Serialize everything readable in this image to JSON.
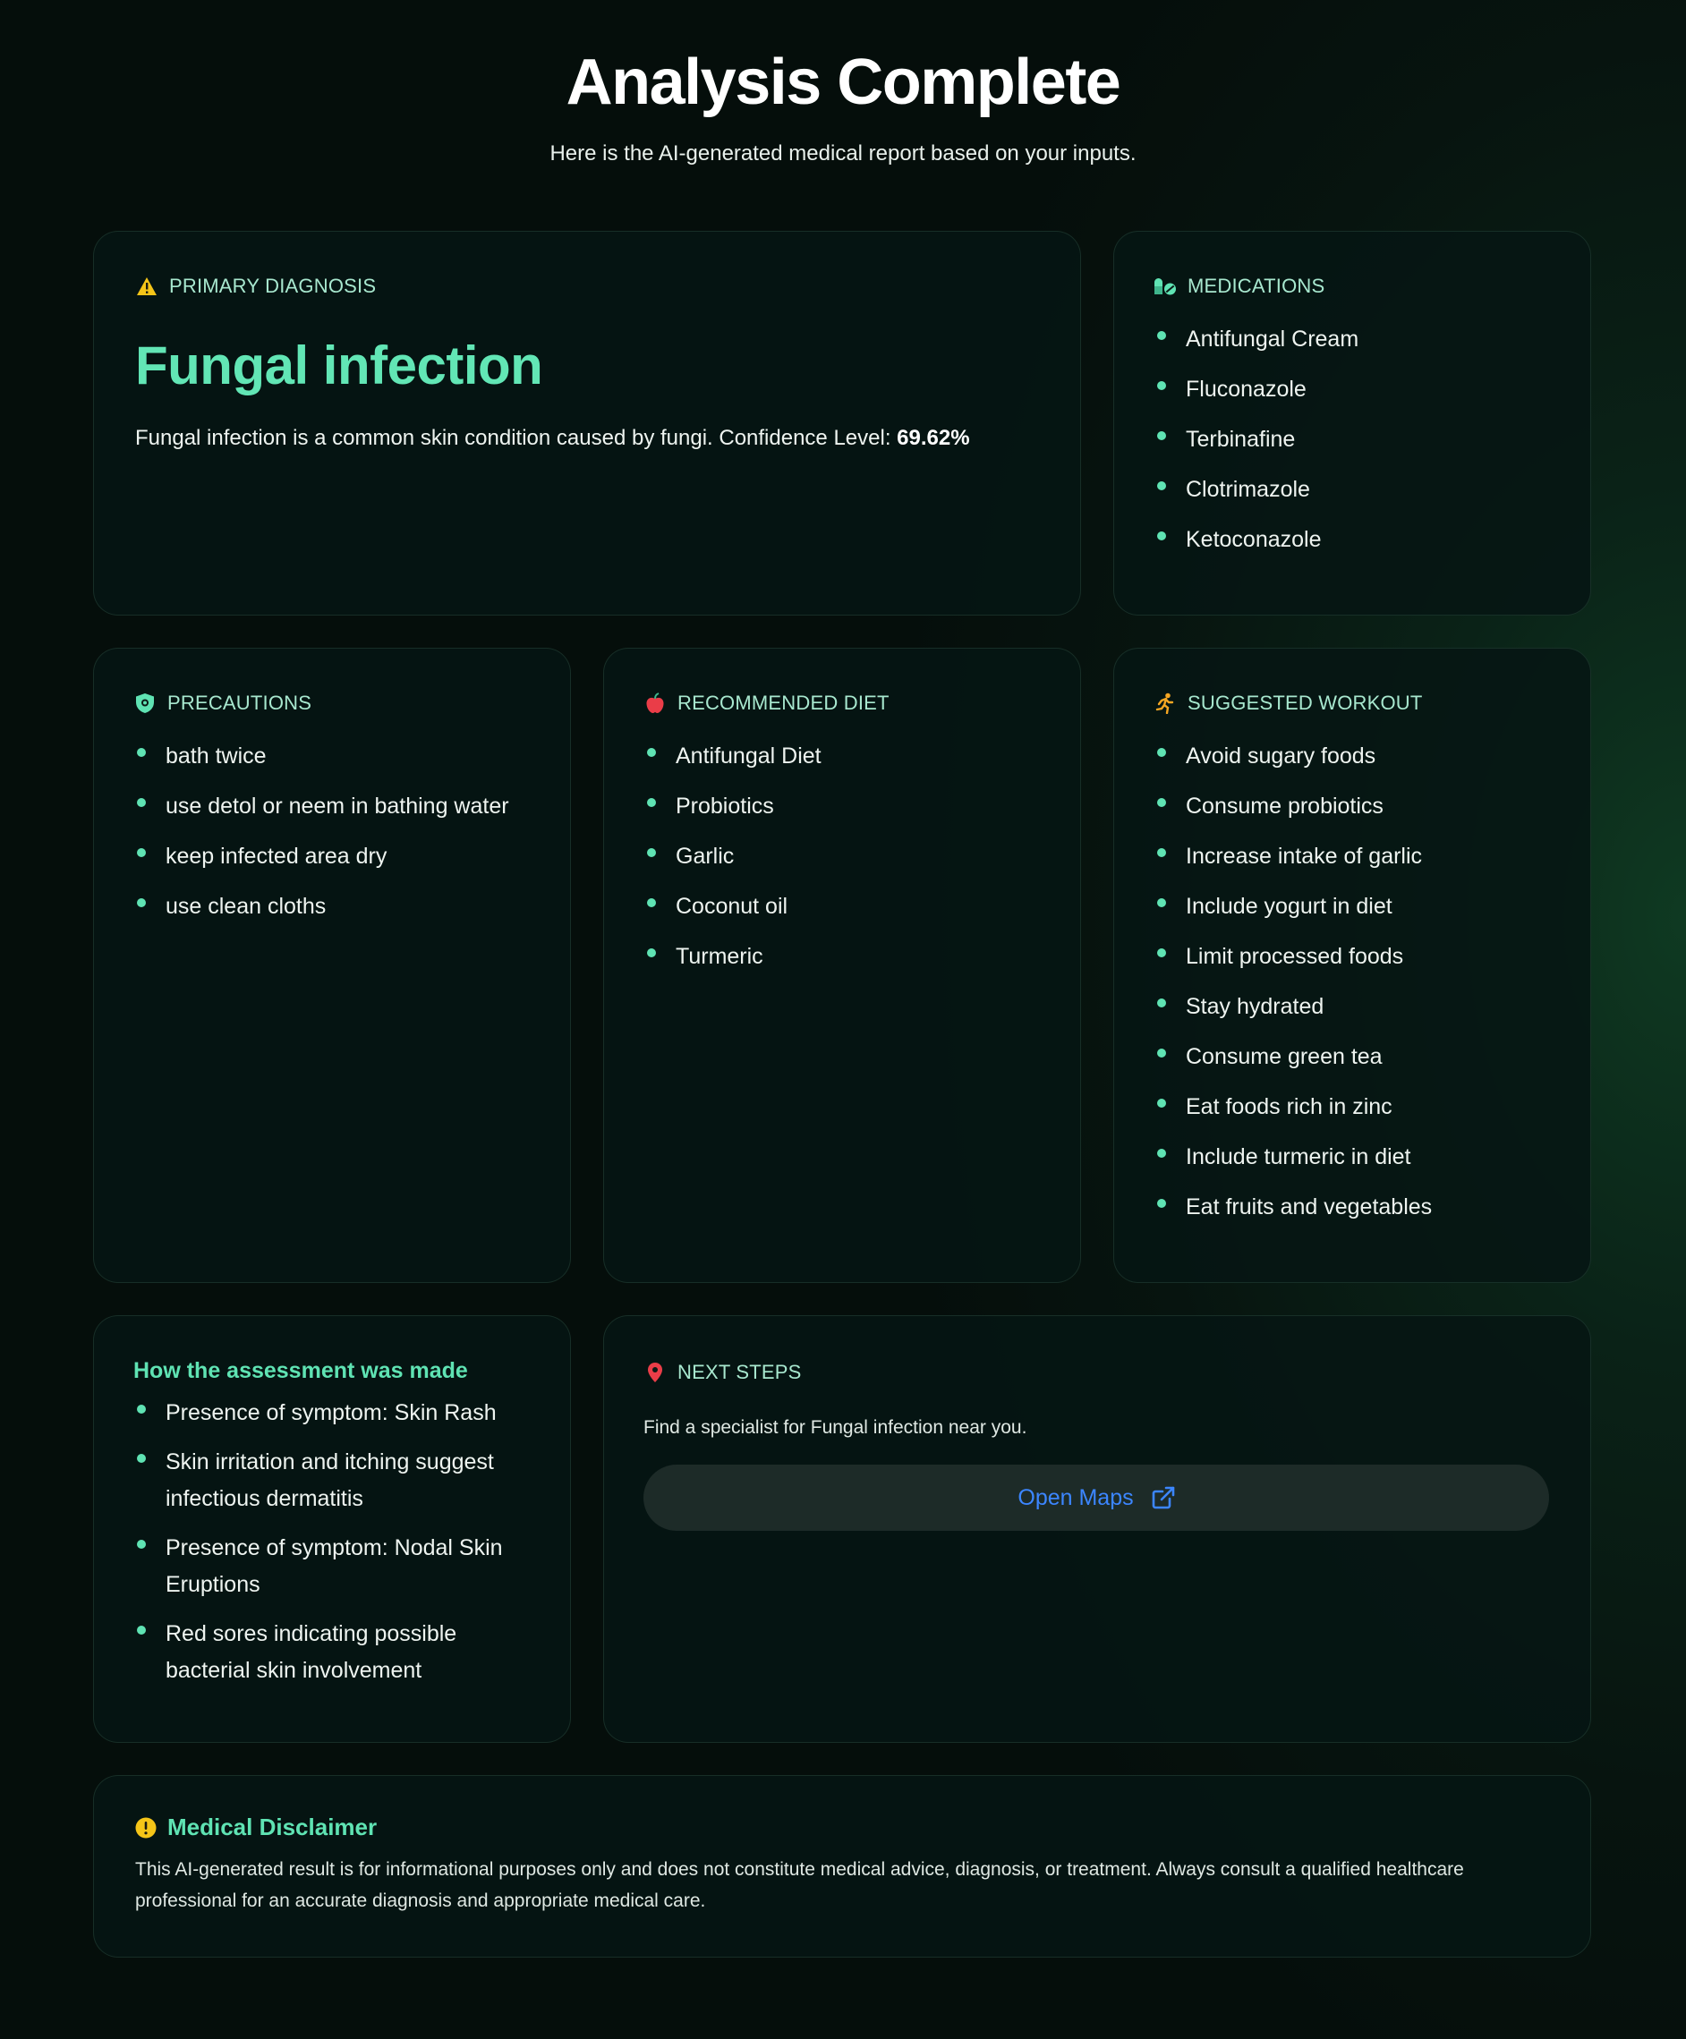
{
  "header": {
    "title": "Analysis Complete",
    "subtitle": "Here is the AI-generated medical report based on your inputs."
  },
  "diagnosis": {
    "heading": "PRIMARY DIAGNOSIS",
    "name": "Fungal infection",
    "description": "Fungal infection is a common skin condition caused by fungi. Confidence Level: ",
    "confidence": "69.62%"
  },
  "medications": {
    "heading": "MEDICATIONS",
    "items": [
      "Antifungal Cream",
      "Fluconazole",
      "Terbinafine",
      "Clotrimazole",
      "Ketoconazole"
    ]
  },
  "precautions": {
    "heading": "PRECAUTIONS",
    "items": [
      "bath twice",
      "use detol or neem in bathing water",
      "keep infected area dry",
      "use clean cloths"
    ]
  },
  "diet": {
    "heading": "RECOMMENDED DIET",
    "items": [
      "Antifungal Diet",
      "Probiotics",
      "Garlic",
      "Coconut oil",
      "Turmeric"
    ]
  },
  "workout": {
    "heading": "SUGGESTED WORKOUT",
    "items": [
      "Avoid sugary foods",
      "Consume probiotics",
      "Increase intake of garlic",
      "Include yogurt in diet",
      "Limit processed foods",
      "Stay hydrated",
      "Consume green tea",
      "Eat foods rich in zinc",
      "Include turmeric in diet",
      "Eat fruits and vegetables"
    ]
  },
  "assessment": {
    "heading": "How the assessment was made",
    "items": [
      "Presence of symptom: Skin Rash",
      "Skin irritation and itching suggest infectious dermatitis",
      "Presence of symptom: Nodal Skin Eruptions",
      "Red sores indicating possible bacterial skin involvement"
    ]
  },
  "next_steps": {
    "heading": "NEXT STEPS",
    "description": "Find a specialist for Fungal infection near you.",
    "button_label": "Open Maps"
  },
  "disclaimer": {
    "heading": "Medical Disclaimer",
    "text": "This AI-generated result is for informational purposes only and does not constitute medical advice, diagnosis, or treatment. Always consult a qualified healthcare professional for an accurate diagnosis and appropriate medical care."
  },
  "icons": {
    "diagnosis": "warning-triangle-icon",
    "medications": "pills-icon",
    "precautions": "shield-icon",
    "diet": "apple-icon",
    "workout": "running-person-icon",
    "next_steps": "map-pin-icon",
    "maps_button": "external-link-icon",
    "disclaimer": "exclamation-circle-icon"
  },
  "colors": {
    "accent": "#5fe3b3",
    "button_text": "#3c86ff",
    "warning": "#f5c518",
    "danger": "#ea3d48"
  }
}
